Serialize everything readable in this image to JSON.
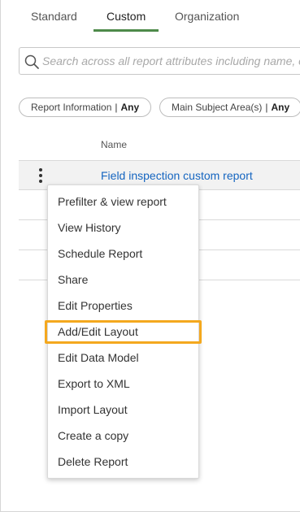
{
  "tabs": [
    {
      "label": "Standard"
    },
    {
      "label": "Custom"
    },
    {
      "label": "Organization"
    }
  ],
  "search": {
    "placeholder": "Search across all report attributes including name, c"
  },
  "filters": [
    {
      "label": "Report Information",
      "separator": "|",
      "value": "Any"
    },
    {
      "label": "Main Subject Area(s)",
      "separator": "|",
      "value": "Any"
    }
  ],
  "table": {
    "column_name": "Name",
    "rows": [
      {
        "name": "Field inspection custom report"
      }
    ]
  },
  "context_menu": {
    "items": [
      {
        "label": "Prefilter & view report"
      },
      {
        "label": "View History"
      },
      {
        "label": "Schedule Report"
      },
      {
        "label": "Share"
      },
      {
        "label": "Edit Properties"
      },
      {
        "label": "Add/Edit Layout"
      },
      {
        "label": "Edit Data Model"
      },
      {
        "label": "Export to XML"
      },
      {
        "label": "Import Layout"
      },
      {
        "label": "Create a copy"
      },
      {
        "label": "Delete Report"
      }
    ],
    "highlighted_item": "Add/Edit Layout"
  },
  "colors": {
    "active_tab_underline": "#4e8a4a",
    "link": "#1565c0",
    "highlight_outline": "#f4a81e"
  },
  "icons": [
    "search-icon",
    "kebab-menu-icon"
  ]
}
